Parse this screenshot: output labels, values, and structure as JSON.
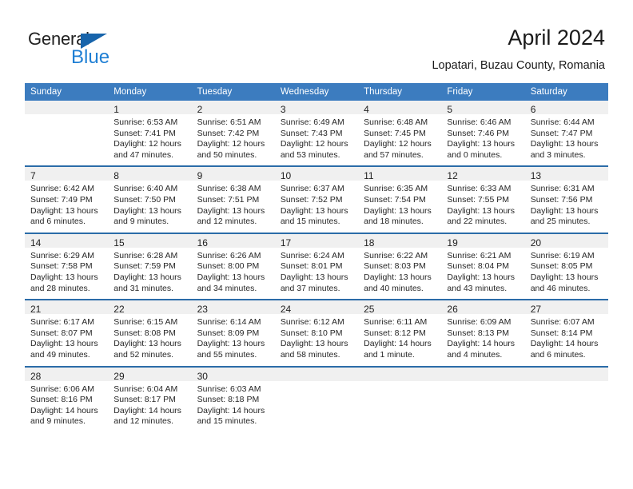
{
  "brand": {
    "name_part1": "General",
    "name_part2": "Blue",
    "accent_color": "#1f7fd4",
    "triangle_color": "#1764ab"
  },
  "header": {
    "title": "April 2024",
    "subtitle": "Lopatari, Buzau County, Romania"
  },
  "theme": {
    "header_row_color": "#3c7cbf",
    "week_divider_color": "#2b6ca8",
    "daynum_band_color": "#f0f0f0"
  },
  "weekdays": [
    "Sunday",
    "Monday",
    "Tuesday",
    "Wednesday",
    "Thursday",
    "Friday",
    "Saturday"
  ],
  "weeks": [
    [
      {
        "day": ""
      },
      {
        "day": "1",
        "sunrise": "Sunrise: 6:53 AM",
        "sunset": "Sunset: 7:41 PM",
        "daylight": "Daylight: 12 hours and 47 minutes."
      },
      {
        "day": "2",
        "sunrise": "Sunrise: 6:51 AM",
        "sunset": "Sunset: 7:42 PM",
        "daylight": "Daylight: 12 hours and 50 minutes."
      },
      {
        "day": "3",
        "sunrise": "Sunrise: 6:49 AM",
        "sunset": "Sunset: 7:43 PM",
        "daylight": "Daylight: 12 hours and 53 minutes."
      },
      {
        "day": "4",
        "sunrise": "Sunrise: 6:48 AM",
        "sunset": "Sunset: 7:45 PM",
        "daylight": "Daylight: 12 hours and 57 minutes."
      },
      {
        "day": "5",
        "sunrise": "Sunrise: 6:46 AM",
        "sunset": "Sunset: 7:46 PM",
        "daylight": "Daylight: 13 hours and 0 minutes."
      },
      {
        "day": "6",
        "sunrise": "Sunrise: 6:44 AM",
        "sunset": "Sunset: 7:47 PM",
        "daylight": "Daylight: 13 hours and 3 minutes."
      }
    ],
    [
      {
        "day": "7",
        "sunrise": "Sunrise: 6:42 AM",
        "sunset": "Sunset: 7:49 PM",
        "daylight": "Daylight: 13 hours and 6 minutes."
      },
      {
        "day": "8",
        "sunrise": "Sunrise: 6:40 AM",
        "sunset": "Sunset: 7:50 PM",
        "daylight": "Daylight: 13 hours and 9 minutes."
      },
      {
        "day": "9",
        "sunrise": "Sunrise: 6:38 AM",
        "sunset": "Sunset: 7:51 PM",
        "daylight": "Daylight: 13 hours and 12 minutes."
      },
      {
        "day": "10",
        "sunrise": "Sunrise: 6:37 AM",
        "sunset": "Sunset: 7:52 PM",
        "daylight": "Daylight: 13 hours and 15 minutes."
      },
      {
        "day": "11",
        "sunrise": "Sunrise: 6:35 AM",
        "sunset": "Sunset: 7:54 PM",
        "daylight": "Daylight: 13 hours and 18 minutes."
      },
      {
        "day": "12",
        "sunrise": "Sunrise: 6:33 AM",
        "sunset": "Sunset: 7:55 PM",
        "daylight": "Daylight: 13 hours and 22 minutes."
      },
      {
        "day": "13",
        "sunrise": "Sunrise: 6:31 AM",
        "sunset": "Sunset: 7:56 PM",
        "daylight": "Daylight: 13 hours and 25 minutes."
      }
    ],
    [
      {
        "day": "14",
        "sunrise": "Sunrise: 6:29 AM",
        "sunset": "Sunset: 7:58 PM",
        "daylight": "Daylight: 13 hours and 28 minutes."
      },
      {
        "day": "15",
        "sunrise": "Sunrise: 6:28 AM",
        "sunset": "Sunset: 7:59 PM",
        "daylight": "Daylight: 13 hours and 31 minutes."
      },
      {
        "day": "16",
        "sunrise": "Sunrise: 6:26 AM",
        "sunset": "Sunset: 8:00 PM",
        "daylight": "Daylight: 13 hours and 34 minutes."
      },
      {
        "day": "17",
        "sunrise": "Sunrise: 6:24 AM",
        "sunset": "Sunset: 8:01 PM",
        "daylight": "Daylight: 13 hours and 37 minutes."
      },
      {
        "day": "18",
        "sunrise": "Sunrise: 6:22 AM",
        "sunset": "Sunset: 8:03 PM",
        "daylight": "Daylight: 13 hours and 40 minutes."
      },
      {
        "day": "19",
        "sunrise": "Sunrise: 6:21 AM",
        "sunset": "Sunset: 8:04 PM",
        "daylight": "Daylight: 13 hours and 43 minutes."
      },
      {
        "day": "20",
        "sunrise": "Sunrise: 6:19 AM",
        "sunset": "Sunset: 8:05 PM",
        "daylight": "Daylight: 13 hours and 46 minutes."
      }
    ],
    [
      {
        "day": "21",
        "sunrise": "Sunrise: 6:17 AM",
        "sunset": "Sunset: 8:07 PM",
        "daylight": "Daylight: 13 hours and 49 minutes."
      },
      {
        "day": "22",
        "sunrise": "Sunrise: 6:15 AM",
        "sunset": "Sunset: 8:08 PM",
        "daylight": "Daylight: 13 hours and 52 minutes."
      },
      {
        "day": "23",
        "sunrise": "Sunrise: 6:14 AM",
        "sunset": "Sunset: 8:09 PM",
        "daylight": "Daylight: 13 hours and 55 minutes."
      },
      {
        "day": "24",
        "sunrise": "Sunrise: 6:12 AM",
        "sunset": "Sunset: 8:10 PM",
        "daylight": "Daylight: 13 hours and 58 minutes."
      },
      {
        "day": "25",
        "sunrise": "Sunrise: 6:11 AM",
        "sunset": "Sunset: 8:12 PM",
        "daylight": "Daylight: 14 hours and 1 minute."
      },
      {
        "day": "26",
        "sunrise": "Sunrise: 6:09 AM",
        "sunset": "Sunset: 8:13 PM",
        "daylight": "Daylight: 14 hours and 4 minutes."
      },
      {
        "day": "27",
        "sunrise": "Sunrise: 6:07 AM",
        "sunset": "Sunset: 8:14 PM",
        "daylight": "Daylight: 14 hours and 6 minutes."
      }
    ],
    [
      {
        "day": "28",
        "sunrise": "Sunrise: 6:06 AM",
        "sunset": "Sunset: 8:16 PM",
        "daylight": "Daylight: 14 hours and 9 minutes."
      },
      {
        "day": "29",
        "sunrise": "Sunrise: 6:04 AM",
        "sunset": "Sunset: 8:17 PM",
        "daylight": "Daylight: 14 hours and 12 minutes."
      },
      {
        "day": "30",
        "sunrise": "Sunrise: 6:03 AM",
        "sunset": "Sunset: 8:18 PM",
        "daylight": "Daylight: 14 hours and 15 minutes."
      },
      {
        "day": ""
      },
      {
        "day": ""
      },
      {
        "day": ""
      },
      {
        "day": ""
      }
    ]
  ]
}
